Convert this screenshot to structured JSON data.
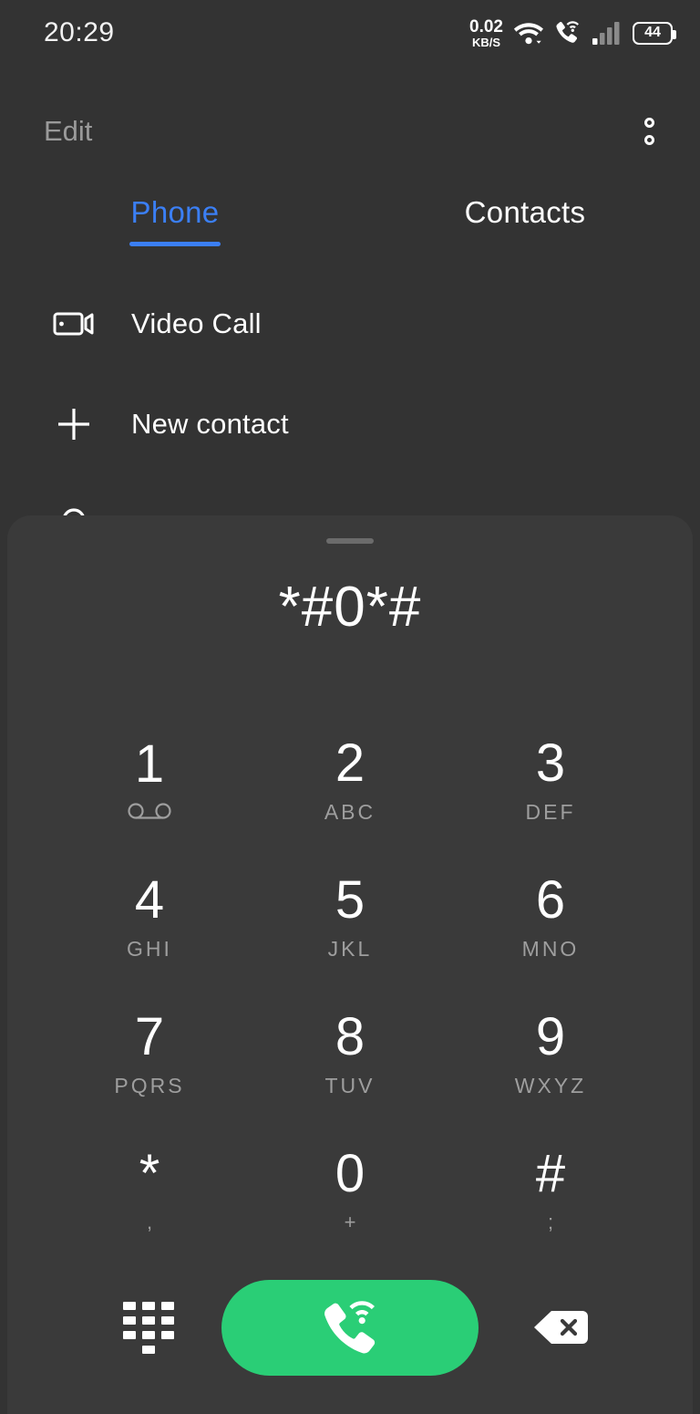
{
  "status_bar": {
    "time": "20:29",
    "net_speed_value": "0.02",
    "net_speed_unit": "KB/S",
    "wifi_icon": "wifi-icon",
    "call_icon": "call-signal-icon",
    "signal_icon": "cellular-signal-icon",
    "battery_level": "44"
  },
  "top_bar": {
    "edit_label": "Edit",
    "overflow_icon": "more-options-icon"
  },
  "tabs": [
    {
      "label": "Phone",
      "active": true
    },
    {
      "label": "Contacts",
      "active": false
    }
  ],
  "list": [
    {
      "label": "Video Call",
      "icon": "video-camera-icon"
    },
    {
      "label": "New contact",
      "icon": "plus-icon"
    },
    {
      "label": "",
      "icon": "contact-icon"
    }
  ],
  "dialer": {
    "number": "*#0*#",
    "handle": "drag-handle",
    "keys": [
      {
        "digit": "1",
        "sub": "",
        "icon": "voicemail-icon"
      },
      {
        "digit": "2",
        "sub": "ABC",
        "icon": ""
      },
      {
        "digit": "3",
        "sub": "DEF",
        "icon": ""
      },
      {
        "digit": "4",
        "sub": "GHI",
        "icon": ""
      },
      {
        "digit": "5",
        "sub": "JKL",
        "icon": ""
      },
      {
        "digit": "6",
        "sub": "MNO",
        "icon": ""
      },
      {
        "digit": "7",
        "sub": "PQRS",
        "icon": ""
      },
      {
        "digit": "8",
        "sub": "TUV",
        "icon": ""
      },
      {
        "digit": "9",
        "sub": "WXYZ",
        "icon": ""
      },
      {
        "digit": "*",
        "sub": ",",
        "icon": ""
      },
      {
        "digit": "0",
        "sub": "+",
        "icon": ""
      },
      {
        "digit": "#",
        "sub": ";",
        "icon": ""
      }
    ],
    "dialpad_toggle_icon": "dialpad-icon",
    "call_icon": "call-phone-icon",
    "backspace_icon": "backspace-icon"
  },
  "colors": {
    "background": "#333333",
    "sheet": "#3a3a3a",
    "accent_blue": "#3b7ff5",
    "call_green": "#2ace76",
    "text_primary": "#ffffff",
    "text_secondary": "#9e9e9e"
  }
}
